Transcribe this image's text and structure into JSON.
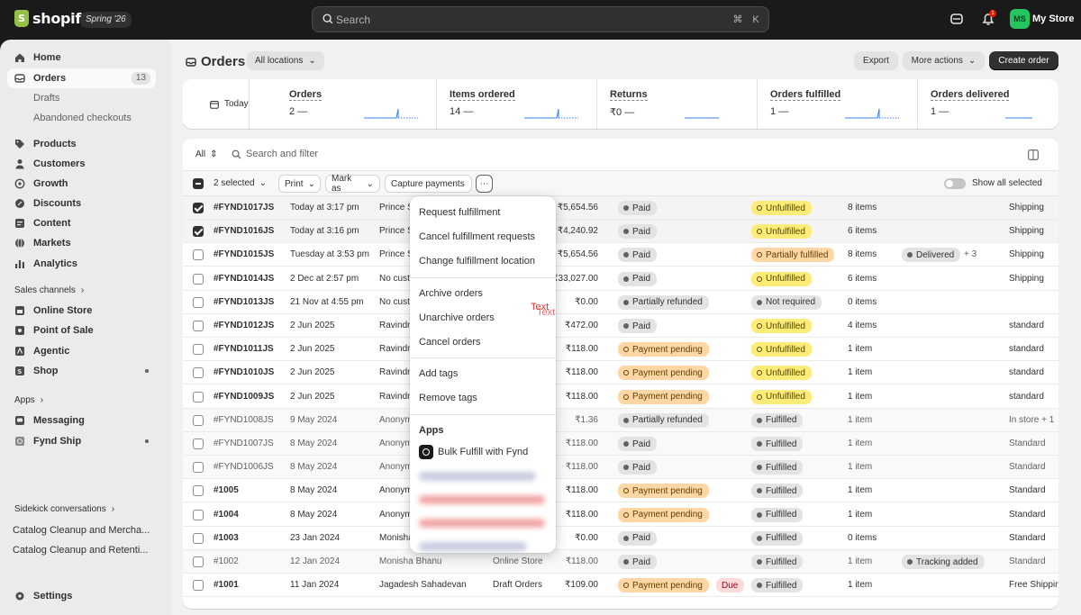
{
  "topbar": {
    "brand": "shopify",
    "version": "Spring '26",
    "search_placeholder": "Search",
    "kbd_cmd": "⌘",
    "kbd_k": "K",
    "notification_count": "1",
    "avatar_initials": "MS",
    "store_name": "My Store"
  },
  "sidebar": {
    "items": [
      {
        "label": "Home"
      },
      {
        "label": "Orders",
        "count": "13"
      },
      {
        "label": "Drafts"
      },
      {
        "label": "Abandoned checkouts"
      },
      {
        "label": "Products"
      },
      {
        "label": "Customers"
      },
      {
        "label": "Growth"
      },
      {
        "label": "Discounts"
      },
      {
        "label": "Content"
      },
      {
        "label": "Markets"
      },
      {
        "label": "Analytics"
      }
    ],
    "sales_channels_label": "Sales channels",
    "channels": [
      {
        "label": "Online Store"
      },
      {
        "label": "Point of Sale"
      },
      {
        "label": "Agentic"
      },
      {
        "label": "Shop"
      }
    ],
    "apps_label": "Apps",
    "apps": [
      {
        "label": "Messaging"
      },
      {
        "label": "Fynd Ship"
      }
    ],
    "sidekick_label": "Sidekick conversations",
    "sidekick": [
      {
        "label": "Catalog Cleanup and Mercha..."
      },
      {
        "label": "Catalog Cleanup and Retenti..."
      }
    ],
    "settings_label": "Settings"
  },
  "page": {
    "title": "Orders",
    "location_filter": "All locations",
    "export_label": "Export",
    "more_actions_label": "More actions",
    "create_order_label": "Create order"
  },
  "metrics": {
    "date_label": "Today",
    "items": [
      {
        "label": "Orders",
        "value": "2",
        "delta": "—"
      },
      {
        "label": "Items ordered",
        "value": "14",
        "delta": "—"
      },
      {
        "label": "Returns",
        "value": "₹0",
        "delta": "—"
      },
      {
        "label": "Orders fulfilled",
        "value": "1",
        "delta": "—"
      },
      {
        "label": "Orders delivered",
        "value": "1",
        "delta": "—"
      }
    ]
  },
  "table": {
    "filter_tab": "All",
    "search_placeholder": "Search and filter",
    "selected_label": "2 selected",
    "print_label": "Print",
    "mark_as_label": "Mark as",
    "capture_label": "Capture payments",
    "show_all_label": "Show all selected",
    "rows": [
      {
        "order": "#FYND1017JS",
        "date": "Today at 3:17 pm",
        "customer": "Prince S",
        "channel": "",
        "total": "₹5,654.56",
        "payment": "Paid",
        "fulfillment": "Unfulfilled",
        "items": "8 items",
        "delivery_status": "",
        "delivery_extra": "",
        "method": "Shipping"
      },
      {
        "order": "#FYND1016JS",
        "date": "Today at 3:16 pm",
        "customer": "Prince S",
        "channel": "",
        "total": "₹4,240.92",
        "payment": "Paid",
        "fulfillment": "Unfulfilled",
        "items": "6 items",
        "delivery_status": "",
        "delivery_extra": "",
        "method": "Shipping"
      },
      {
        "order": "#FYND1015JS",
        "date": "Tuesday at 3:53 pm",
        "customer": "Prince S",
        "channel": "",
        "total": "₹5,654.56",
        "payment": "Paid",
        "fulfillment": "Partially fulfilled",
        "items": "8 items",
        "delivery_status": "Delivered",
        "delivery_extra": "+ 3",
        "method": "Shipping"
      },
      {
        "order": "#FYND1014JS",
        "date": "2 Dec at 2:57 pm",
        "customer": "No cust",
        "channel": "",
        "total": "₹33,027.00",
        "payment": "Paid",
        "fulfillment": "Unfulfilled",
        "items": "6 items",
        "delivery_status": "",
        "delivery_extra": "",
        "method": "Shipping"
      },
      {
        "order": "#FYND1013JS",
        "date": "21 Nov at 4:55 pm",
        "customer": "No cust",
        "channel": "",
        "total": "₹0.00",
        "payment": "Partially refunded",
        "fulfillment": "Not required",
        "items": "0 items",
        "delivery_status": "",
        "delivery_extra": "",
        "method": ""
      },
      {
        "order": "#FYND1012JS",
        "date": "2 Jun 2025",
        "customer": "Ravindr",
        "channel": "",
        "total": "₹472.00",
        "payment": "Paid",
        "fulfillment": "Unfulfilled",
        "items": "4 items",
        "delivery_status": "",
        "delivery_extra": "",
        "method": "standard"
      },
      {
        "order": "#FYND1011JS",
        "date": "2 Jun 2025",
        "customer": "Ravindr",
        "channel": "",
        "total": "₹118.00",
        "payment": "Payment pending",
        "fulfillment": "Unfulfilled",
        "items": "1 item",
        "delivery_status": "",
        "delivery_extra": "",
        "method": "standard"
      },
      {
        "order": "#FYND1010JS",
        "date": "2 Jun 2025",
        "customer": "Ravindr",
        "channel": "",
        "total": "₹118.00",
        "payment": "Payment pending",
        "fulfillment": "Unfulfilled",
        "items": "1 item",
        "delivery_status": "",
        "delivery_extra": "",
        "method": "standard"
      },
      {
        "order": "#FYND1009JS",
        "date": "2 Jun 2025",
        "customer": "Ravindr",
        "channel": "",
        "total": "₹118.00",
        "payment": "Payment pending",
        "fulfillment": "Unfulfilled",
        "items": "1 item",
        "delivery_status": "",
        "delivery_extra": "",
        "method": "standard"
      },
      {
        "order": "#FYND1008JS",
        "date": "9 May 2024",
        "customer": "Anonym",
        "channel": "",
        "total": "₹1.36",
        "payment": "Partially refunded",
        "fulfillment": "Fulfilled",
        "items": "1 item",
        "delivery_status": "",
        "delivery_extra": "",
        "method": "In store + 1"
      },
      {
        "order": "#FYND1007JS",
        "date": "8 May 2024",
        "customer": "Anonym",
        "channel": "",
        "total": "₹118.00",
        "payment": "Paid",
        "fulfillment": "Fulfilled",
        "items": "1 item",
        "delivery_status": "",
        "delivery_extra": "",
        "method": "Standard"
      },
      {
        "order": "#FYND1006JS",
        "date": "8 May 2024",
        "customer": "Anonym",
        "channel": "",
        "total": "₹118.00",
        "payment": "Paid",
        "fulfillment": "Fulfilled",
        "items": "1 item",
        "delivery_status": "",
        "delivery_extra": "",
        "method": "Standard"
      },
      {
        "order": "#1005",
        "date": "8 May 2024",
        "customer": "Anonym",
        "channel": "",
        "total": "₹118.00",
        "payment": "Payment pending",
        "fulfillment": "Fulfilled",
        "items": "1 item",
        "delivery_status": "",
        "delivery_extra": "",
        "method": "Standard"
      },
      {
        "order": "#1004",
        "date": "8 May 2024",
        "customer": "Anonym",
        "channel": "",
        "total": "₹118.00",
        "payment": "Payment pending",
        "fulfillment": "Fulfilled",
        "items": "1 item",
        "delivery_status": "",
        "delivery_extra": "",
        "method": "Standard"
      },
      {
        "order": "#1003",
        "date": "23 Jan 2024",
        "customer": "Monisha",
        "channel": "",
        "total": "₹0.00",
        "payment": "Paid",
        "fulfillment": "Fulfilled",
        "items": "0 items",
        "delivery_status": "",
        "delivery_extra": "",
        "method": "Standard"
      },
      {
        "order": "#1002",
        "date": "12 Jan 2024",
        "customer": "Monisha Bhanu",
        "channel": "Online Store",
        "total": "₹118.00",
        "payment": "Paid",
        "fulfillment": "Fulfilled",
        "items": "1 item",
        "delivery_status": "Tracking added",
        "delivery_extra": "",
        "method": "Standard"
      },
      {
        "order": "#1001",
        "date": "11 Jan 2024",
        "customer": "Jagadesh Sahadevan",
        "channel": "Draft Orders",
        "total": "₹109.00",
        "payment": "Payment pending",
        "payment_extra": "Due",
        "fulfillment": "Fulfilled",
        "items": "1 item",
        "delivery_status": "",
        "delivery_extra": "",
        "method": "Free Shippin"
      }
    ]
  },
  "menu": {
    "group1": [
      "Request fulfillment",
      "Cancel fulfillment requests",
      "Change fulfillment location"
    ],
    "group2": [
      "Archive orders",
      "Unarchive orders",
      "Cancel orders"
    ],
    "group3": [
      "Add tags",
      "Remove tags"
    ],
    "apps_heading": "Apps",
    "app_item": "Bulk Fulfill with Fynd",
    "overlay_text_1": "Text",
    "overlay_text_2": "Text"
  },
  "colors": {
    "accent_green": "#95bf47",
    "avatar_green": "#22c55e",
    "pending_orange": "#ffd6a4",
    "unfulfilled_yellow": "#ffeb78",
    "due_red": "#fedad9"
  }
}
